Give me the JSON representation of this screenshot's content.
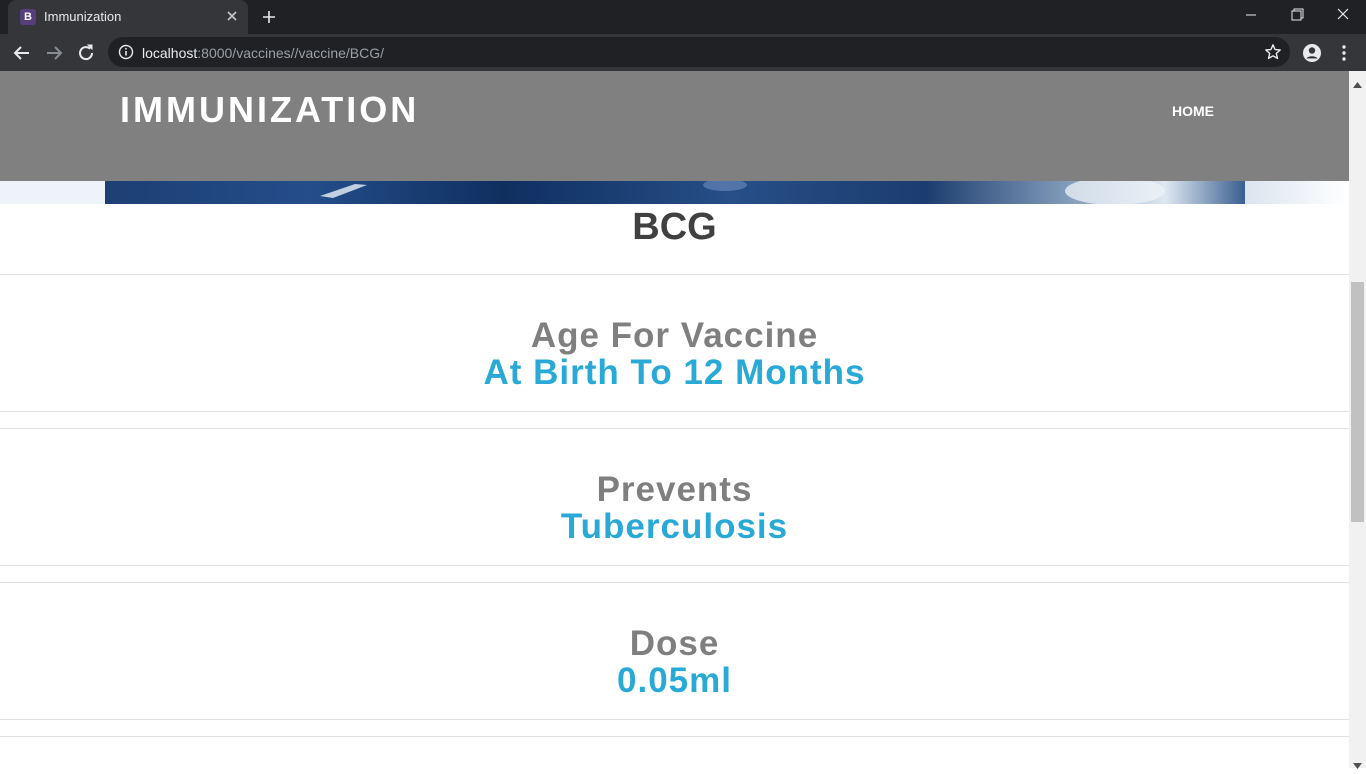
{
  "browser": {
    "tab_title": "Immunization",
    "tab_favicon_letter": "B",
    "url_host": "localhost",
    "url_rest": ":8000/vaccines//vaccine/BCG/"
  },
  "site": {
    "brand": "IMMUNIZATION",
    "nav": {
      "home": "HOME"
    }
  },
  "vaccine": {
    "name": "BCG",
    "sections": [
      {
        "label": "Age For Vaccine",
        "value": "At Birth To 12 Months"
      },
      {
        "label": "Prevents",
        "value": "Tuberculosis"
      },
      {
        "label": "Dose",
        "value": "0.05ml"
      }
    ]
  },
  "colors": {
    "header_bg": "#808080",
    "label_gray": "#7f7f7f",
    "value_blue": "#29a9d6"
  }
}
